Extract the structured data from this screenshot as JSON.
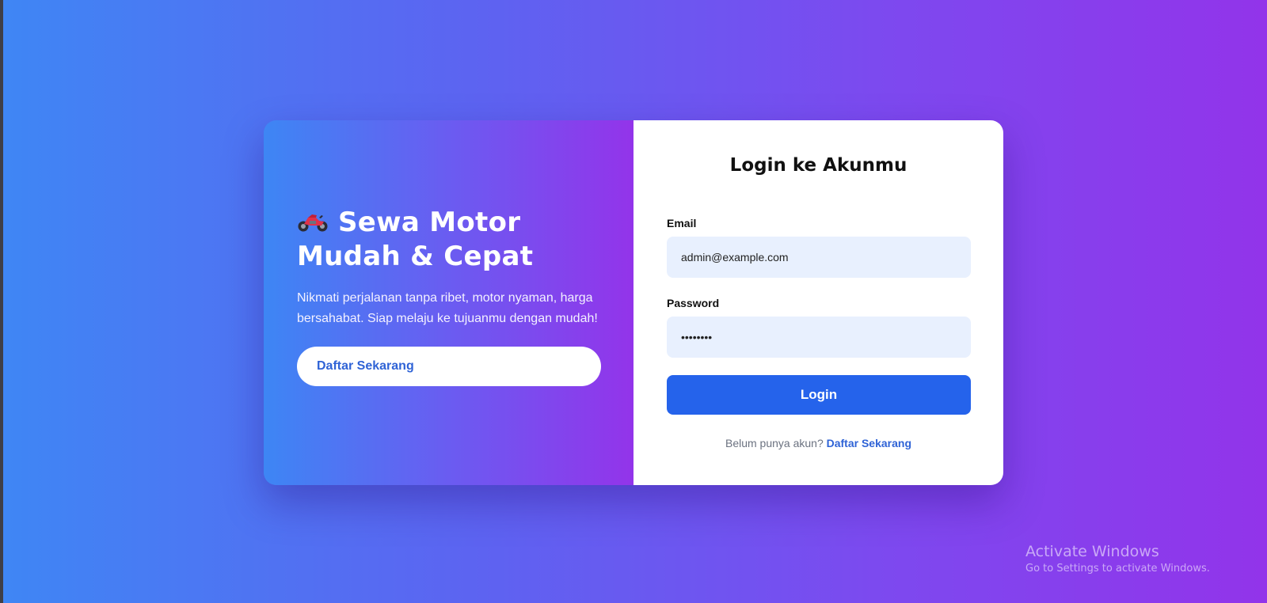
{
  "colors": {
    "background_start": "#3f86f4",
    "background_end": "#9234ea",
    "primary_button": "#2563eb",
    "link": "#2f63d6",
    "input_bg": "#e8f0fe"
  },
  "hero": {
    "icon": "motorcycle-icon",
    "title": "Sewa Motor Mudah & Cepat",
    "description": "Nikmati perjalanan tanpa ribet, motor nyaman, harga bersahabat. Siap melaju ke tujuanmu dengan mudah!",
    "register_button": "Daftar Sekarang"
  },
  "form": {
    "title": "Login ke Akunmu",
    "email_label": "Email",
    "email_value": "admin@example.com",
    "password_label": "Password",
    "password_value": "••••••••",
    "login_button": "Login",
    "signup_prompt": "Belum punya akun?",
    "signup_link": "Daftar Sekarang"
  },
  "watermark": {
    "title": "Activate Windows",
    "subtitle": "Go to Settings to activate Windows."
  }
}
